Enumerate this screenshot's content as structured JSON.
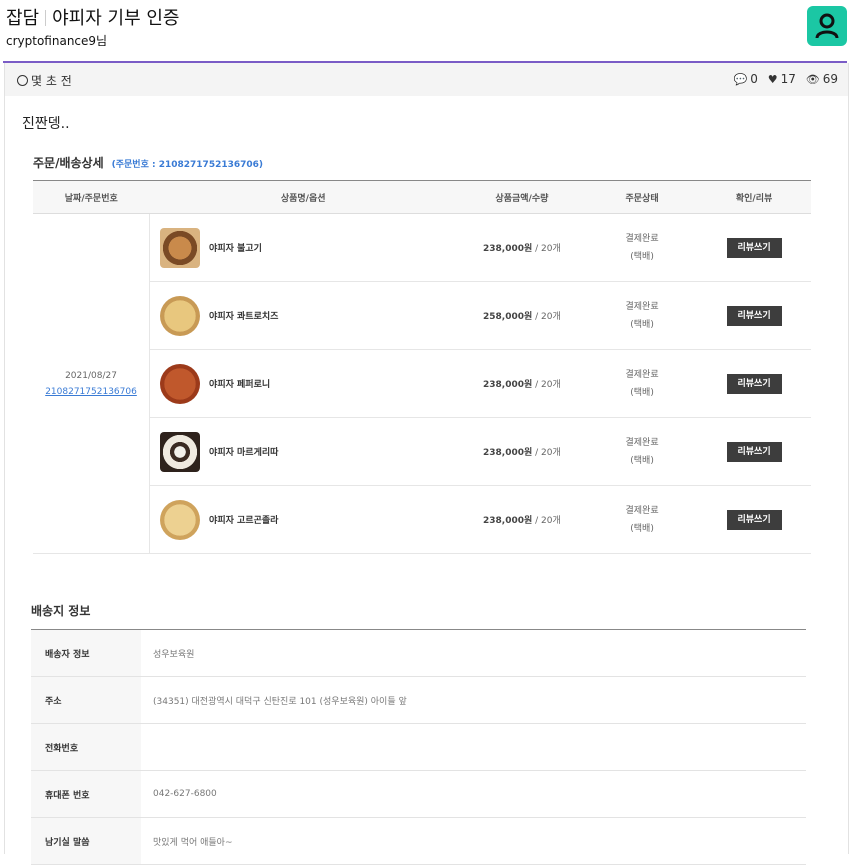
{
  "post": {
    "category": "잡담",
    "title": "야피자 기부 인증",
    "author": "cryptofinance9님",
    "time": "몇 초 전",
    "comments": "0",
    "likes": "17",
    "views": "69",
    "body": "진짠뎅.."
  },
  "order": {
    "section_title": "주문/배송상세",
    "order_number_label": "(주문번호 : 2108271752136706)",
    "columns": [
      "날짜/주문번호",
      "상품명/옵션",
      "상품금액/수량",
      "주문상태",
      "확인/리뷰"
    ],
    "date": "2021/08/27",
    "number": "2108271752136706",
    "items": [
      {
        "name": "야피자 불고기",
        "price": "238,000원",
        "qty": "/ 20개",
        "status1": "결제완료",
        "status2": "(택배)",
        "button": "리뷰쓰기"
      },
      {
        "name": "야피자 콰트로치즈",
        "price": "258,000원",
        "qty": "/ 20개",
        "status1": "결제완료",
        "status2": "(택배)",
        "button": "리뷰쓰기"
      },
      {
        "name": "야피자 페퍼로니",
        "price": "238,000원",
        "qty": "/ 20개",
        "status1": "결제완료",
        "status2": "(택배)",
        "button": "리뷰쓰기"
      },
      {
        "name": "야피자 마르게리따",
        "price": "238,000원",
        "qty": "/ 20개",
        "status1": "결제완료",
        "status2": "(택배)",
        "button": "리뷰쓰기"
      },
      {
        "name": "야피자 고르곤졸라",
        "price": "238,000원",
        "qty": "/ 20개",
        "status1": "결제완료",
        "status2": "(택배)",
        "button": "리뷰쓰기"
      }
    ]
  },
  "shipping": {
    "section_title": "배송지 정보",
    "rows": [
      {
        "label": "배송자 정보",
        "value": "성우보육원"
      },
      {
        "label": "주소",
        "value": "(34351) 대전광역시 대덕구 신탄진로 101 (성우보육원) 아이들 앞"
      },
      {
        "label": "전화번호",
        "value": ""
      },
      {
        "label": "휴대폰 번호",
        "value": "042-627-6800"
      },
      {
        "label": "남기실 말씀",
        "value": "맛있게 먹어 애들아~"
      }
    ]
  },
  "colors": {
    "accent": "#7a5cc6",
    "avatar": "#1bc7a4",
    "link": "#3a7bd5"
  }
}
